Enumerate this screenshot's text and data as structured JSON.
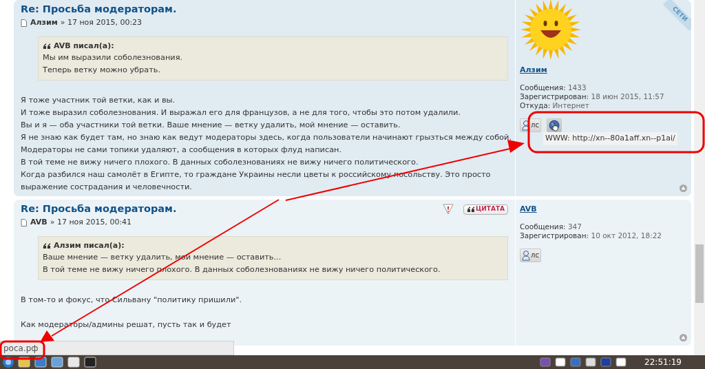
{
  "posts": [
    {
      "title": "Re: Просьба модераторам.",
      "author": "Алзим",
      "date": "» 17 ноя 2015, 00:23",
      "quote": {
        "cite": "AVB писал(а):",
        "lines": [
          "Мы им выразили соболезнования.",
          "Теперь ветку можно убрать."
        ]
      },
      "body": [
        [
          "Я тоже участник той ветки, как и вы.",
          "И тоже выразил соболезнования. И выражал его для французов, а не для того, чтобы это потом удалили.",
          "Вы и я — оба участники той ветки. Ваше мнение — ветку удалить, мой мнение — оставить.",
          "Я не знаю как будет там, но знаю как ведут модераторы здесь, когда пользователи начинают грызться между собой.",
          "Модераторы не сами топики удаляют, а сообщения в которых флуд написан.",
          "В той теме не вижу ничего плохого. В данных соболезнованиях не вижу ничего политического.",
          "Когда разбился наш самолёт в Египте, то граждане Украины несли цветы к российскому посольству. Это просто",
          "выражение сострадания и человечности."
        ]
      ],
      "profile": {
        "name": "Алзим",
        "avatar": true,
        "ribbon": "СЕТИ",
        "fields": [
          {
            "label": "Сообщения:",
            "value": "1433"
          },
          {
            "label": "Зарегистрирован:",
            "value": "18 июн 2015, 11:57"
          },
          {
            "label": "Откуда:",
            "value": "Интернет"
          }
        ],
        "buttons": [
          {
            "kind": "pm",
            "label": "лс",
            "hovered": false
          },
          {
            "kind": "www",
            "hovered": true
          }
        ],
        "tooltip": "WWW: http://xn--80a1aff.xn--p1ai/"
      }
    },
    {
      "title": "Re: Просьба модераторам.",
      "author": "AVB",
      "date": "» 17 ноя 2015, 00:41",
      "actions": [
        {
          "kind": "report"
        },
        {
          "kind": "quote",
          "label": "ЦИТАТА"
        }
      ],
      "quote": {
        "cite": "Алзим писал(а):",
        "lines": [
          "Ваше мнение — ветку удалить, мой мнение — оставить...",
          "В той теме не вижу ничего плохого. В данных соболезнованиях не вижу ничего политического."
        ]
      },
      "body": [
        [
          "В том-то и фокус, что Сильвану \"политику пришили\"."
        ],
        [
          "Как модераторы/админы решат, пусть так и будет"
        ]
      ],
      "profile": {
        "name": "AVB",
        "avatar": false,
        "fields": [
          {
            "label": "Сообщения:",
            "value": "347"
          },
          {
            "label": "Зарегистрирован:",
            "value": "10 окт 2012, 18:22"
          }
        ],
        "buttons": [
          {
            "kind": "pm",
            "label": "лс",
            "hovered": false
          }
        ]
      }
    }
  ],
  "status_url": "роса.рф",
  "taskbar": {
    "clock": "22:51:19"
  }
}
